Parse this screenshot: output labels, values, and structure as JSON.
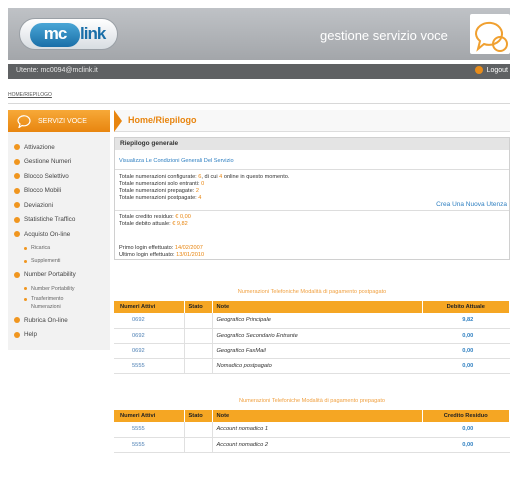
{
  "header": {
    "logo_mc": "mc",
    "logo_link": "link",
    "app_title": "gestione servizio voce"
  },
  "userbar": {
    "user": "Utente: mc0094@mclink.it",
    "logout": "Logout"
  },
  "breadcrumb": "HOME/RIEPILOGO",
  "sidebar": {
    "header": "SERVIZI VOCE",
    "items": [
      {
        "label": "Attivazione",
        "level": 0
      },
      {
        "label": "Gestione Numeri",
        "level": 0
      },
      {
        "label": "Blocco Selettivo",
        "level": 0
      },
      {
        "label": "Blocco Mobili",
        "level": 0
      },
      {
        "label": "Deviazioni",
        "level": 0
      },
      {
        "label": "Statistiche Traffico",
        "level": 0
      },
      {
        "label": "Acquisto On-line",
        "level": 0
      },
      {
        "label": "Ricarica",
        "level": 1
      },
      {
        "label": "Supplementi",
        "level": 1
      },
      {
        "label": "Number Portability",
        "level": 0
      },
      {
        "label": "Number Portability",
        "level": 1
      },
      {
        "label": "Trasferimento Numerazioni",
        "level": 2
      },
      {
        "label": "Rubrica On-line",
        "level": 0
      },
      {
        "label": "Help",
        "level": 0
      }
    ]
  },
  "main": {
    "title": "Home/Riepilogo",
    "summary": {
      "heading": "Riepilogo generale",
      "conditions_link": "Visualizza Le Condizioni Generali Del Servizio",
      "configured_prefix": "Totale numerazioni configurate: ",
      "configured_count": "6",
      "configured_mid": ", di cui ",
      "online_count": "4",
      "configured_suffix": " online in questo momento.",
      "incoming_label": "Totale numerazioni solo entranti: ",
      "incoming_value": "0",
      "prepaid_label": "Totale numerazioni prepagate: ",
      "prepaid_value": "2",
      "postpaid_label": "Totale numerazioni postpagate: ",
      "postpaid_value": "4",
      "create_user": "Crea Una Nuova Utenza",
      "credit_label": "Totale credito residuo: ",
      "credit_value": "€ 0,00",
      "debit_label": "Totale debito attuale: ",
      "debit_value": "€ 9,82",
      "first_login_label": "Primo login effettuato: ",
      "first_login_value": "14/02/2007",
      "last_login_label": "Ultimo login effettuato: ",
      "last_login_value": "13/01/2010"
    },
    "postpaid": {
      "caption": "Numerazioni Telefoniche Modalità di pagamento postpagato",
      "headers": [
        "Numeri Attivi",
        "Stato",
        "Note",
        "Debito Attuale"
      ],
      "rows": [
        {
          "numero": "0692",
          "note": "Geografico Principale",
          "value": "9,82"
        },
        {
          "numero": "0692",
          "note": "Geografico Secondario Entrante",
          "value": "0,00"
        },
        {
          "numero": "0692",
          "note": "Geografico FaxMail",
          "value": "0,00"
        },
        {
          "numero": "5555",
          "note": "Nomadico postpagato",
          "value": "0,00"
        }
      ]
    },
    "prepaid": {
      "caption": "Numerazioni Telefoniche Modalità di pagamento prepagato",
      "headers": [
        "Numeri Attivi",
        "Stato",
        "Note",
        "Credito Residuo"
      ],
      "rows": [
        {
          "numero": "5555",
          "note": "Account nomadico 1",
          "value": "0,00"
        },
        {
          "numero": "5555",
          "note": "Account nomadico 2",
          "value": "0,00"
        }
      ]
    }
  },
  "colors": {
    "accent_orange": "#f5a623",
    "link_blue": "#2e7fc1",
    "header_grey": "#b0b3b7"
  }
}
